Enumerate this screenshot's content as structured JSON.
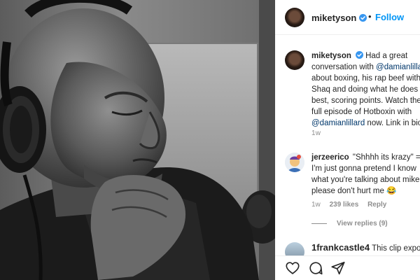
{
  "post": {
    "account": "miketyson",
    "follow_separator": "•",
    "follow_label": "Follow",
    "photo_alt": "Black and white photo of Mike Tyson wearing headphones in a studio"
  },
  "caption": {
    "username": "miketyson",
    "text_1": "Had a great conversation with ",
    "mention_1": "@damianlillard",
    "text_2": " about boxing, his rap beef with Shaq and doing what he does best, scoring points. Watch the full episode of Hotboxin with ",
    "mention_2": "@damianlillard",
    "text_3": " now. Link in bio.",
    "time": "1w"
  },
  "comments": [
    {
      "username": "jerzeerico",
      "text": "\"Shhhh its krazy\" = I'm just gonna pretend I know what you're talking about mike, please don't hurt me",
      "emoji": "😂",
      "time": "1w",
      "likes": "239 likes",
      "reply_label": "Reply",
      "view_replies": "View replies (9)"
    },
    {
      "username": "1frankcastle4",
      "text": "This clip exposes"
    }
  ],
  "actions": {
    "like_icon": "heart-icon",
    "comment_icon": "comment-icon",
    "share_icon": "share-icon"
  },
  "colors": {
    "link_blue": "#0095f6",
    "mention_blue": "#00376b",
    "verified_blue": "#3897f0",
    "meta_gray": "#8e8e8e"
  }
}
